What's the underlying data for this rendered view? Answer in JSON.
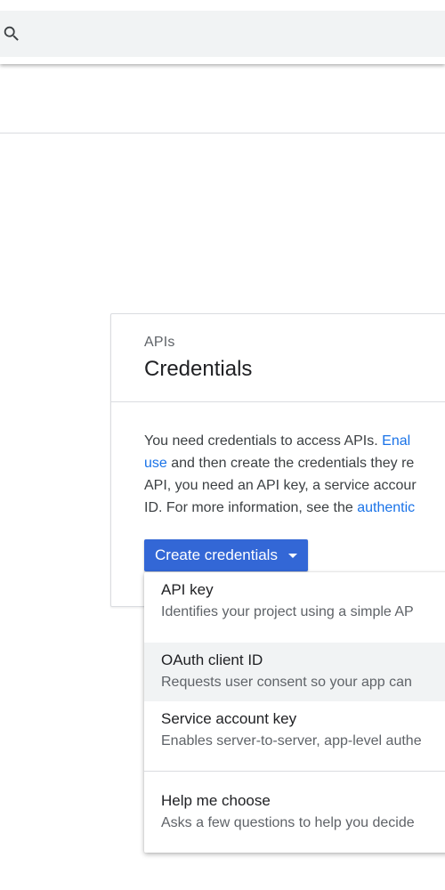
{
  "search": {
    "value": "",
    "placeholder": ""
  },
  "card": {
    "eyebrow": "APIs",
    "title": "Credentials",
    "body": {
      "line1_text": "You need credentials to access APIs. ",
      "line1_link": "Enal",
      "line2_link": "use",
      "line2_text": " and then create the credentials they re",
      "line3_text": "API, you need an API key, a service accour",
      "line4_text": "ID. For more information, see the ",
      "line4_link": "authentic"
    }
  },
  "create_button": {
    "label": "Create credentials",
    "icon": "caret-down-icon"
  },
  "dropdown": {
    "items": [
      {
        "title": "API key",
        "description": "Identifies your project using a simple AP"
      },
      {
        "title": "OAuth client ID",
        "description": "Requests user consent so your app can"
      },
      {
        "title": "Service account key",
        "description": "Enables server-to-server, app-level authe"
      },
      {
        "title": "Help me choose",
        "description": "Asks a few questions to help you decide"
      }
    ],
    "highlighted_index": 1
  },
  "colors": {
    "accent": "#3367d6",
    "link": "#1a73e8",
    "highlight_bg": "#f1f3f4",
    "divider": "#dadce0"
  }
}
